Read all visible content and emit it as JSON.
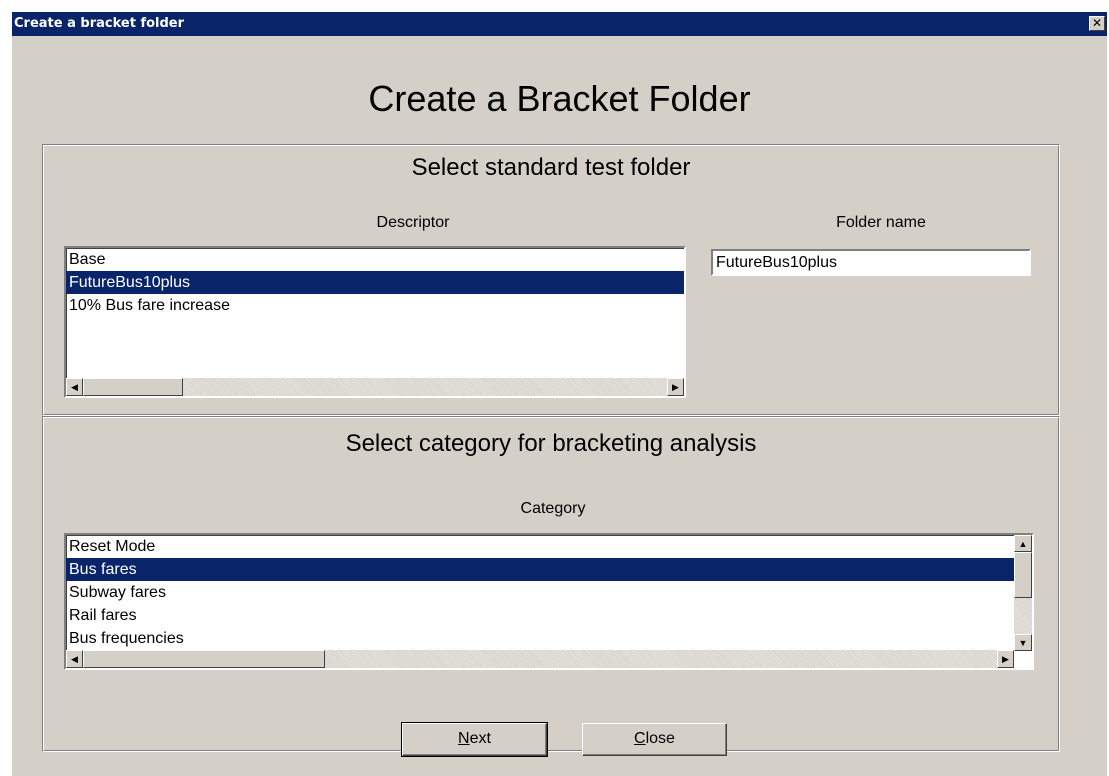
{
  "window": {
    "title": "Create a bracket folder",
    "close_glyph": "✕"
  },
  "main_title": "Create a Bracket Folder",
  "section1": {
    "heading": "Select standard test folder",
    "descriptor_label": "Descriptor",
    "folder_name_label": "Folder name",
    "descriptor_items": [
      "Base",
      "FutureBus10plus",
      "10% Bus fare increase"
    ],
    "selected_descriptor": "FutureBus10plus",
    "folder_name_value": "FutureBus10plus"
  },
  "section2": {
    "heading": "Select category for bracketing analysis",
    "category_label": "Category",
    "category_items": [
      "Reset Mode",
      "Bus fares",
      "Subway fares",
      "Rail fares",
      "Bus frequencies"
    ],
    "selected_category": "Bus fares"
  },
  "buttons": {
    "next_accel": "N",
    "next_rest": "ext",
    "close_accel": "C",
    "close_rest": "lose"
  },
  "icons": {
    "scroll_left": "◀",
    "scroll_right": "▶",
    "scroll_up": "▲",
    "scroll_down": "▼"
  },
  "colors": {
    "titlebar": "#0a246a",
    "dialog_bg": "#d4d0c8",
    "selection": "#0a246a"
  }
}
